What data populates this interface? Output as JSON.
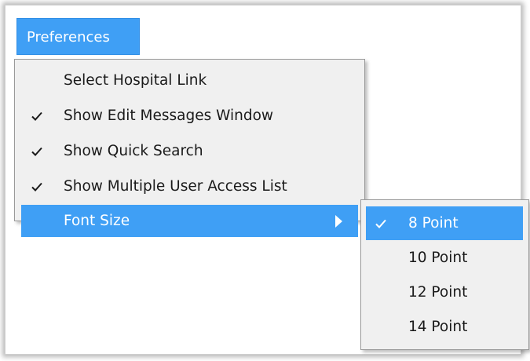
{
  "menubar": {
    "preferences_label": "Preferences"
  },
  "menu": {
    "items": [
      {
        "label": "Select Hospital Link",
        "checked": false
      },
      {
        "label": "Show Edit Messages Window",
        "checked": true
      },
      {
        "label": "Show Quick Search",
        "checked": true
      },
      {
        "label": "Show Multiple User Access List",
        "checked": true
      },
      {
        "label": "Font Size",
        "checked": false,
        "has_submenu": true,
        "highlighted": true
      }
    ]
  },
  "submenu": {
    "items": [
      {
        "label": "8 Point",
        "checked": true,
        "highlighted": true
      },
      {
        "label": "10 Point",
        "checked": false
      },
      {
        "label": "12 Point",
        "checked": false
      },
      {
        "label": "14 Point",
        "checked": false
      }
    ]
  },
  "colors": {
    "highlight": "#3f9ff5",
    "menu_background": "#f0f0f0",
    "menu_border": "#9a9a9a"
  },
  "icons": {
    "check": "check-icon",
    "submenu_arrow": "chevron-right-icon"
  }
}
